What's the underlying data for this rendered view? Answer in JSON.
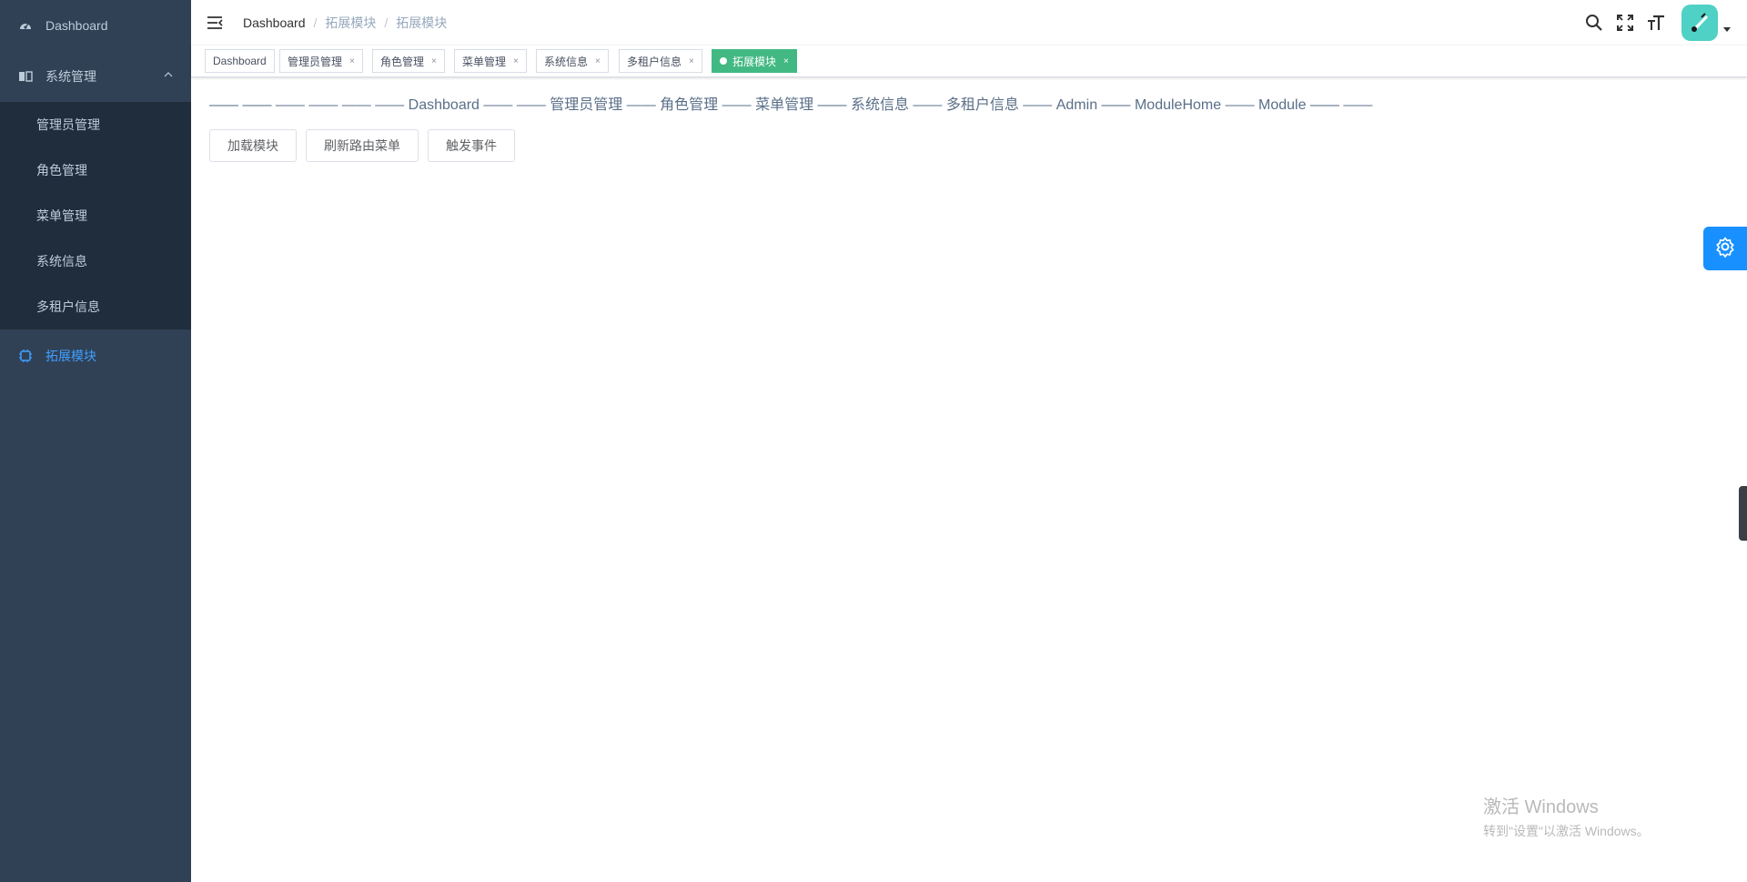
{
  "sidebar": {
    "dashboard_label": "Dashboard",
    "system_label": "系统管理",
    "sub_items": [
      "管理员管理",
      "角色管理",
      "菜单管理",
      "系统信息",
      "多租户信息"
    ],
    "extension_label": "拓展模块"
  },
  "navbar": {
    "breadcrumb": [
      "Dashboard",
      "拓展模块",
      "拓展模块"
    ]
  },
  "tags": [
    "Dashboard",
    "管理员管理",
    "角色管理",
    "菜单管理",
    "系统信息",
    "多租户信息",
    "拓展模块"
  ],
  "tag_close": "×",
  "main": {
    "route_line": "—— —— —— —— —— —— Dashboard —— —— 管理员管理 —— 角色管理 —— 菜单管理 —— 系统信息 —— 多租户信息 —— Admin —— ModuleHome —— Module —— ——",
    "buttons": [
      "加载模块",
      "刷新路由菜单",
      "触发事件"
    ]
  },
  "watermark": {
    "line1": "激活 Windows",
    "line2": "转到\"设置\"以激活 Windows。"
  },
  "colors": {
    "sidebar_bg": "#304156",
    "submenu_bg": "#1f2d3d",
    "active_link": "#409eff",
    "active_tag": "#42b983",
    "settings_btn": "#1890ff"
  }
}
